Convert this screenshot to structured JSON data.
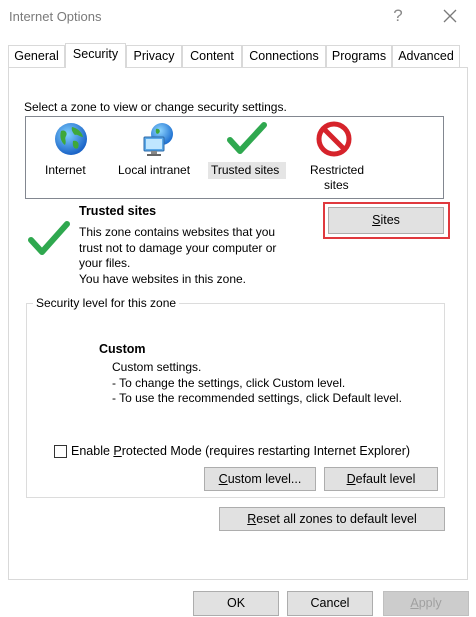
{
  "window": {
    "title": "Internet Options",
    "help_glyph": "?"
  },
  "tabs": [
    {
      "label": "General",
      "active": false
    },
    {
      "label": "Security",
      "active": true
    },
    {
      "label": "Privacy",
      "active": false
    },
    {
      "label": "Content",
      "active": false
    },
    {
      "label": "Connections",
      "active": false
    },
    {
      "label": "Programs",
      "active": false
    },
    {
      "label": "Advanced",
      "active": false
    }
  ],
  "zones": {
    "prompt": "Select a zone to view or change security settings.",
    "items": [
      {
        "label": "Internet",
        "icon": "globe-icon",
        "selected": false
      },
      {
        "label": "Local intranet",
        "icon": "intranet-icon",
        "selected": false
      },
      {
        "label": "Trusted sites",
        "icon": "checkmark-icon",
        "selected": true
      },
      {
        "label_line1": "Restricted",
        "label_line2": "sites",
        "icon": "restricted-icon",
        "selected": false
      }
    ]
  },
  "selected_zone": {
    "title": "Trusted sites",
    "desc_lines": [
      "This zone contains websites that you",
      "trust not to damage your computer or",
      "your files.",
      "You have websites in this zone."
    ],
    "sites_button": {
      "mnemonic": "S",
      "rest": "ites"
    }
  },
  "security_level": {
    "group_label": "Security level for this zone",
    "title": "Custom",
    "desc_lines": [
      "Custom settings.",
      "- To change the settings, click Custom level.",
      "- To use the recommended settings, click Default level."
    ],
    "protected_mode": {
      "pre": "Enable ",
      "mnemonic": "P",
      "rest": "rotected Mode (requires restarting Internet Explorer)",
      "checked": false
    },
    "custom_level_button": {
      "mnemonic": "C",
      "rest": "ustom level..."
    },
    "default_level_button": {
      "mnemonic": "D",
      "rest": "efault level"
    },
    "reset_button": {
      "mnemonic": "R",
      "rest": "eset all zones to default level"
    }
  },
  "footer": {
    "ok": "OK",
    "cancel": "Cancel",
    "apply_mnemonic": "A",
    "apply_rest": "pply"
  },
  "colors": {
    "highlight": "#e0393e",
    "check_green": "#2fa84f",
    "restricted_red": "#d6232b"
  }
}
